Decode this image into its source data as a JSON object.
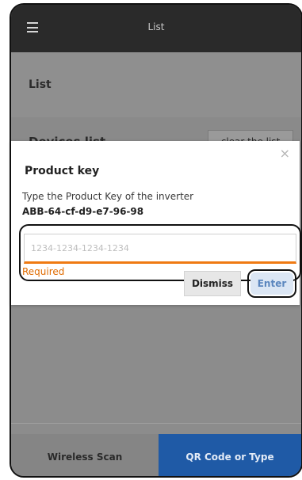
{
  "appbar": {
    "title": "List",
    "menu_icon": "hamburger-menu-icon"
  },
  "section": {
    "list_label": "List"
  },
  "devices": {
    "title": "Devices list",
    "clear_label": "clear the list"
  },
  "modal": {
    "title": "Product key",
    "description": "Type the Product Key of the inverter",
    "device_id": "ABB-64-cf-d9-e7-96-98",
    "input_placeholder": "1234-1234-1234-1234",
    "input_value": "",
    "error_text": "Required",
    "dismiss_label": "Dismiss",
    "enter_label": "Enter",
    "close_glyph": "×"
  },
  "tabs": {
    "wireless": "Wireless Scan",
    "qr": "QR Code or Type"
  },
  "colors": {
    "accent": "#1f5aa6",
    "error": "#e06b00",
    "input_underline": "#ef7a12"
  }
}
